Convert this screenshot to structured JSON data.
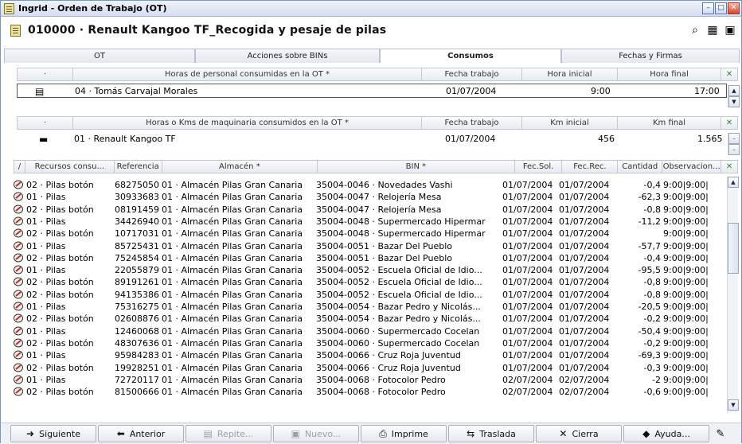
{
  "window": {
    "title": "Ingrid - Orden de Trabajo (OT)"
  },
  "header": {
    "title": "010000 · Renault Kangoo TF_Recogida y pesaje de pilas"
  },
  "tabs": [
    "OT",
    "Acciones sobre BINs",
    "Consumos",
    "Fechas y Firmas"
  ],
  "personal": {
    "columns": [
      "·",
      "Horas de personal consumidas en la OT *",
      "Fecha trabajo",
      "Hora inicial",
      "Hora final"
    ],
    "row": {
      "name": "04 · Tomás Carvajal Morales",
      "fecha": "01/07/2004",
      "inicio": "9:00",
      "fin": "17:00"
    }
  },
  "maquinaria": {
    "columns": [
      "·",
      "Horas o Kms de maquinaria consumidos en la OT *",
      "Fecha trabajo",
      "Km inicial",
      "Km final"
    ],
    "row": {
      "name": "01 · Renault Kangoo TF",
      "fecha": "01/07/2004",
      "inicio": "456",
      "fin": "1.565"
    }
  },
  "consumos": {
    "columns": [
      "Recursos consu...",
      "Referencia",
      "Almacén *",
      "BIN *",
      "Fec.Sol.",
      "Fec.Rec.",
      "Cantidad",
      "Observacion..."
    ],
    "rows": [
      [
        "02 · Pilas botón",
        "68275050",
        "01 · Almacén Pilas Gran Canaria",
        "35004-0046 · Novedades Vashi",
        "01/07/2004",
        "01/07/2004",
        "-0,4",
        "9:00|9:00|"
      ],
      [
        "01 · Pilas",
        "30933683",
        "01 · Almacén Pilas Gran Canaria",
        "35004-0047 · Relojería Mesa",
        "01/07/2004",
        "01/07/2004",
        "-62,3",
        "9:00|9:00|"
      ],
      [
        "02 · Pilas botón",
        "08191459",
        "01 · Almacén Pilas Gran Canaria",
        "35004-0047 · Relojería Mesa",
        "01/07/2004",
        "01/07/2004",
        "-0,8",
        "9:00|9:00|"
      ],
      [
        "01 · Pilas",
        "34426940",
        "01 · Almacén Pilas Gran Canaria",
        "35004-0048 · Supermercado Hipermar",
        "01/07/2004",
        "01/07/2004",
        "-11,2",
        "9:00|9:00|"
      ],
      [
        "02 · Pilas botón",
        "10717031",
        "01 · Almacén Pilas Gran Canaria",
        "35004-0048 · Supermercado Hipermar",
        "01/07/2004",
        "01/07/2004",
        "",
        "9:00|9:00|"
      ],
      [
        "01 · Pilas",
        "85725431",
        "01 · Almacén Pilas Gran Canaria",
        "35004-0051 · Bazar Del Pueblo",
        "01/07/2004",
        "01/07/2004",
        "-57,7",
        "9:00|9:00|"
      ],
      [
        "02 · Pilas botón",
        "75245854",
        "01 · Almacén Pilas Gran Canaria",
        "35004-0051 · Bazar Del Pueblo",
        "01/07/2004",
        "01/07/2004",
        "-0,4",
        "9:00|9:00|"
      ],
      [
        "01 · Pilas",
        "22055879",
        "01 · Almacén Pilas Gran Canaria",
        "35004-0052 · Escuela Oficial de Idio...",
        "01/07/2004",
        "01/07/2004",
        "-95,5",
        "9:00|9:00|"
      ],
      [
        "02 · Pilas botón",
        "89191261",
        "01 · Almacén Pilas Gran Canaria",
        "35004-0052 · Escuela Oficial de Idio...",
        "01/07/2004",
        "01/07/2004",
        "-0,8",
        "9:00|9:00|"
      ],
      [
        "02 · Pilas botón",
        "94135386",
        "01 · Almacén Pilas Gran Canaria",
        "35004-0052 · Escuela Oficial de Idio...",
        "01/07/2004",
        "01/07/2004",
        "-0,8",
        "9:00|9:00|"
      ],
      [
        "01 · Pilas",
        "75316275",
        "01 · Almacén Pilas Gran Canaria",
        "35004-0054 · Bazar Pedro y Nicolás...",
        "01/07/2004",
        "01/07/2004",
        "-20,5",
        "9:00|9:00|"
      ],
      [
        "02 · Pilas botón",
        "02608876",
        "01 · Almacén Pilas Gran Canaria",
        "35004-0054 · Bazar Pedro y Nicolás...",
        "01/07/2004",
        "01/07/2004",
        "-0,2",
        "9:00|9:00|"
      ],
      [
        "01 · Pilas",
        "12460068",
        "01 · Almacén Pilas Gran Canaria",
        "35004-0060 · Supermercado Cocelan",
        "01/07/2004",
        "01/07/2004",
        "-50,4",
        "9:00|9:00|"
      ],
      [
        "02 · Pilas botón",
        "48307636",
        "01 · Almacén Pilas Gran Canaria",
        "35004-0060 · Supermercado Cocelan",
        "01/07/2004",
        "01/07/2004",
        "-0,2",
        "9:00|9:00|"
      ],
      [
        "01 · Pilas",
        "95984283",
        "01 · Almacén Pilas Gran Canaria",
        "35004-0066 · Cruz Roja Juventud",
        "01/07/2004",
        "01/07/2004",
        "-69,3",
        "9:00|9:00|"
      ],
      [
        "02 · Pilas botón",
        "19928251",
        "01 · Almacén Pilas Gran Canaria",
        "35004-0066 · Cruz Roja Juventud",
        "01/07/2004",
        "01/07/2004",
        "-0,3",
        "9:00|9:00|"
      ],
      [
        "01 · Pilas",
        "72720117",
        "01 · Almacén Pilas Gran Canaria",
        "35004-0068 · Fotocolor Pedro",
        "02/07/2004",
        "02/07/2004",
        "-2",
        "9:00|9:00|"
      ],
      [
        "02 · Pilas botón",
        "81500666",
        "01 · Almacén Pilas Gran Canaria",
        "35004-0068 · Fotocolor Pedro",
        "02/07/2004",
        "02/07/2004",
        "-0,6",
        "9:00|9:00|"
      ]
    ]
  },
  "buttons": {
    "siguiente": "Siguiente",
    "anterior": "Anterior",
    "repite": "Repite...",
    "nuevo": "Nuevo...",
    "imprime": "Imprime",
    "traslada": "Traslada",
    "cierra": "Cierra",
    "ayuda": "Ayuda..."
  },
  "colors": {
    "accent": "#2a8a3a",
    "border": "#7a96c8"
  }
}
